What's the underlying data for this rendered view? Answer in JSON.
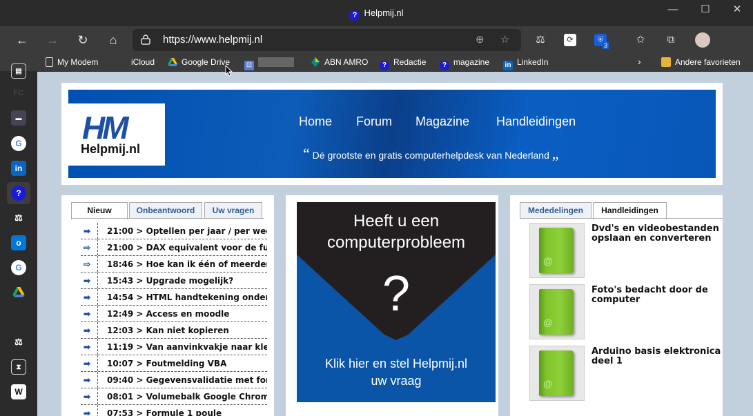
{
  "window": {
    "title": "Helpmij.nl",
    "minimize": "—",
    "maximize": "☐",
    "close": "✕"
  },
  "toolbar": {
    "back": "←",
    "forward": "→",
    "refresh": "↻",
    "home": "⌂",
    "url": "https://www.helpmij.nl",
    "zoom_icon": "⊕",
    "fav_icon": "☆",
    "ext_badge": "3"
  },
  "bookmarks": [
    {
      "label": "My Modem",
      "icon": "page-icon"
    },
    {
      "label": "iCloud",
      "icon": "apple-icon"
    },
    {
      "label": "Google Drive",
      "icon": "google-drive-icon"
    },
    {
      "label": "ABN AMRO",
      "icon": "abn-amro-icon"
    },
    {
      "label": "Redactie",
      "icon": "helpmij-icon"
    },
    {
      "label": "magazine",
      "icon": "helpmij-icon"
    },
    {
      "label": "LinkedIn",
      "icon": "linkedin-icon"
    },
    {
      "label": "Andere favorieten",
      "icon": "folder-icon"
    }
  ],
  "header": {
    "logo_mark": "HM",
    "logo_text": "Helpmij.nl",
    "nav": [
      "Home",
      "Forum",
      "Magazine",
      "Handleidingen"
    ],
    "tagline": "Dé grootste en gratis computerhelpdesk van Nederland",
    "quote_open": "“",
    "quote_close": "„"
  },
  "left_panel": {
    "tabs": [
      "Nieuw",
      "Onbeantwoord",
      "Uw vragen"
    ],
    "active_tab": "Nieuw",
    "rows": [
      {
        "time": "21:00",
        "title": "Optellen per jaar / per week",
        "read": false
      },
      {
        "time": "21:00",
        "title": "DAX equivalent voor de funct...",
        "read": true
      },
      {
        "time": "18:46",
        "title": "Hoe kan ik één of meerdere k...",
        "read": true
      },
      {
        "time": "15:43",
        "title": "Upgrade mogelijk?",
        "read": false
      },
      {
        "time": "14:54",
        "title": "HTML handtekening onder do",
        "read": false
      },
      {
        "time": "12:49",
        "title": "Access en moodle",
        "read": false
      },
      {
        "time": "12:03",
        "title": "Kan niet kopieren",
        "read": false
      },
      {
        "time": "11:19",
        "title": "Van aanvinkvakje naar kleur...",
        "read": false
      },
      {
        "time": "10:07",
        "title": "Foutmelding VBA",
        "read": false
      },
      {
        "time": "09:40",
        "title": "Gegevensvalidatie met formul",
        "read": false
      },
      {
        "time": "08:01",
        "title": "Volumebalk Google Chrome w",
        "read": false
      },
      {
        "time": "07:53",
        "title": "Formule 1 poule",
        "read": false
      }
    ]
  },
  "promo": {
    "line1": "Heeft u een",
    "line2": "computerprobleem",
    "mark": "?",
    "foot1": "Klik hier en stel Helpmij.nl",
    "foot2": "uw vraag"
  },
  "right_panel": {
    "tabs": [
      "Mededelingen",
      "Handleidingen"
    ],
    "active_tab": "Handleidingen",
    "items": [
      {
        "title": "Dvd's en videobestanden opslaan en converteren"
      },
      {
        "title": "Foto's bedacht door de computer"
      },
      {
        "title": "Arduino basis elektronica deel 1"
      }
    ]
  },
  "colors": {
    "brand_blue": "#0a55a7",
    "dark": "#231f20",
    "page_bg": "#c2d0dd",
    "green": "#7ec42a"
  }
}
